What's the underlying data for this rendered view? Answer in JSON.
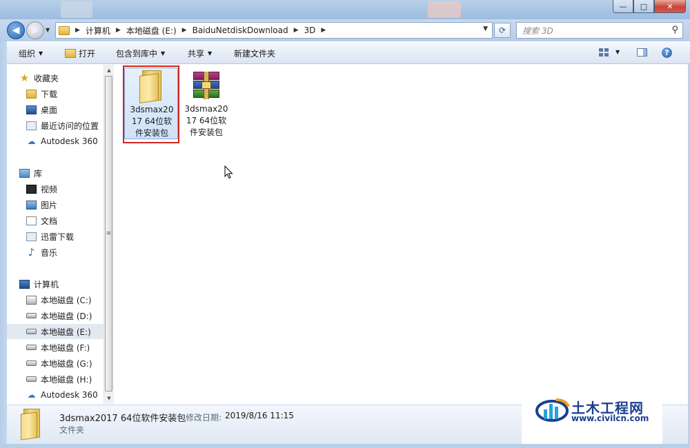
{
  "window": {
    "minimize": "—",
    "maximize": "□",
    "close": "✕"
  },
  "address": {
    "crumbs": [
      "计算机",
      "本地磁盘 (E:)",
      "BaiduNetdiskDownload",
      "3D"
    ],
    "search_placeholder": "搜索 3D"
  },
  "toolbar": {
    "organize": "组织",
    "open": "打开",
    "include_in_library": "包含到库中",
    "share": "共享",
    "new_folder": "新建文件夹"
  },
  "sidebar": {
    "favorites_header": "收藏夹",
    "favorites": [
      "下载",
      "桌面",
      "最近访问的位置",
      "Autodesk 360"
    ],
    "libraries_header": "库",
    "libraries": [
      "视频",
      "图片",
      "文档",
      "迅雷下载",
      "音乐"
    ],
    "computer_header": "计算机",
    "drives": [
      "本地磁盘 (C:)",
      "本地磁盘 (D:)",
      "本地磁盘 (E:)",
      "本地磁盘 (F:)",
      "本地磁盘 (G:)",
      "本地磁盘 (H:)",
      "Autodesk 360"
    ]
  },
  "files": [
    {
      "name": "3dsmax2017 64位软件安装包",
      "lines": [
        "3dsmax20",
        "17 64位软",
        "件安装包"
      ],
      "type": "folder",
      "selected": true
    },
    {
      "name": "3dsmax2017 64位软件安装包",
      "lines": [
        "3dsmax20",
        "17 64位软",
        "件安装包"
      ],
      "type": "rar",
      "selected": false
    }
  ],
  "details": {
    "name": "3dsmax2017 64位软件安装包",
    "modified_label": "修改日期:",
    "modified_value": "2019/8/16 11:15",
    "type": "文件夹"
  },
  "watermark": {
    "title": "土木工程网",
    "url": "www.civilcn.com"
  },
  "colors": {
    "selection_frame": "#d2231d",
    "watermark_blue": "#1b3f8f"
  }
}
